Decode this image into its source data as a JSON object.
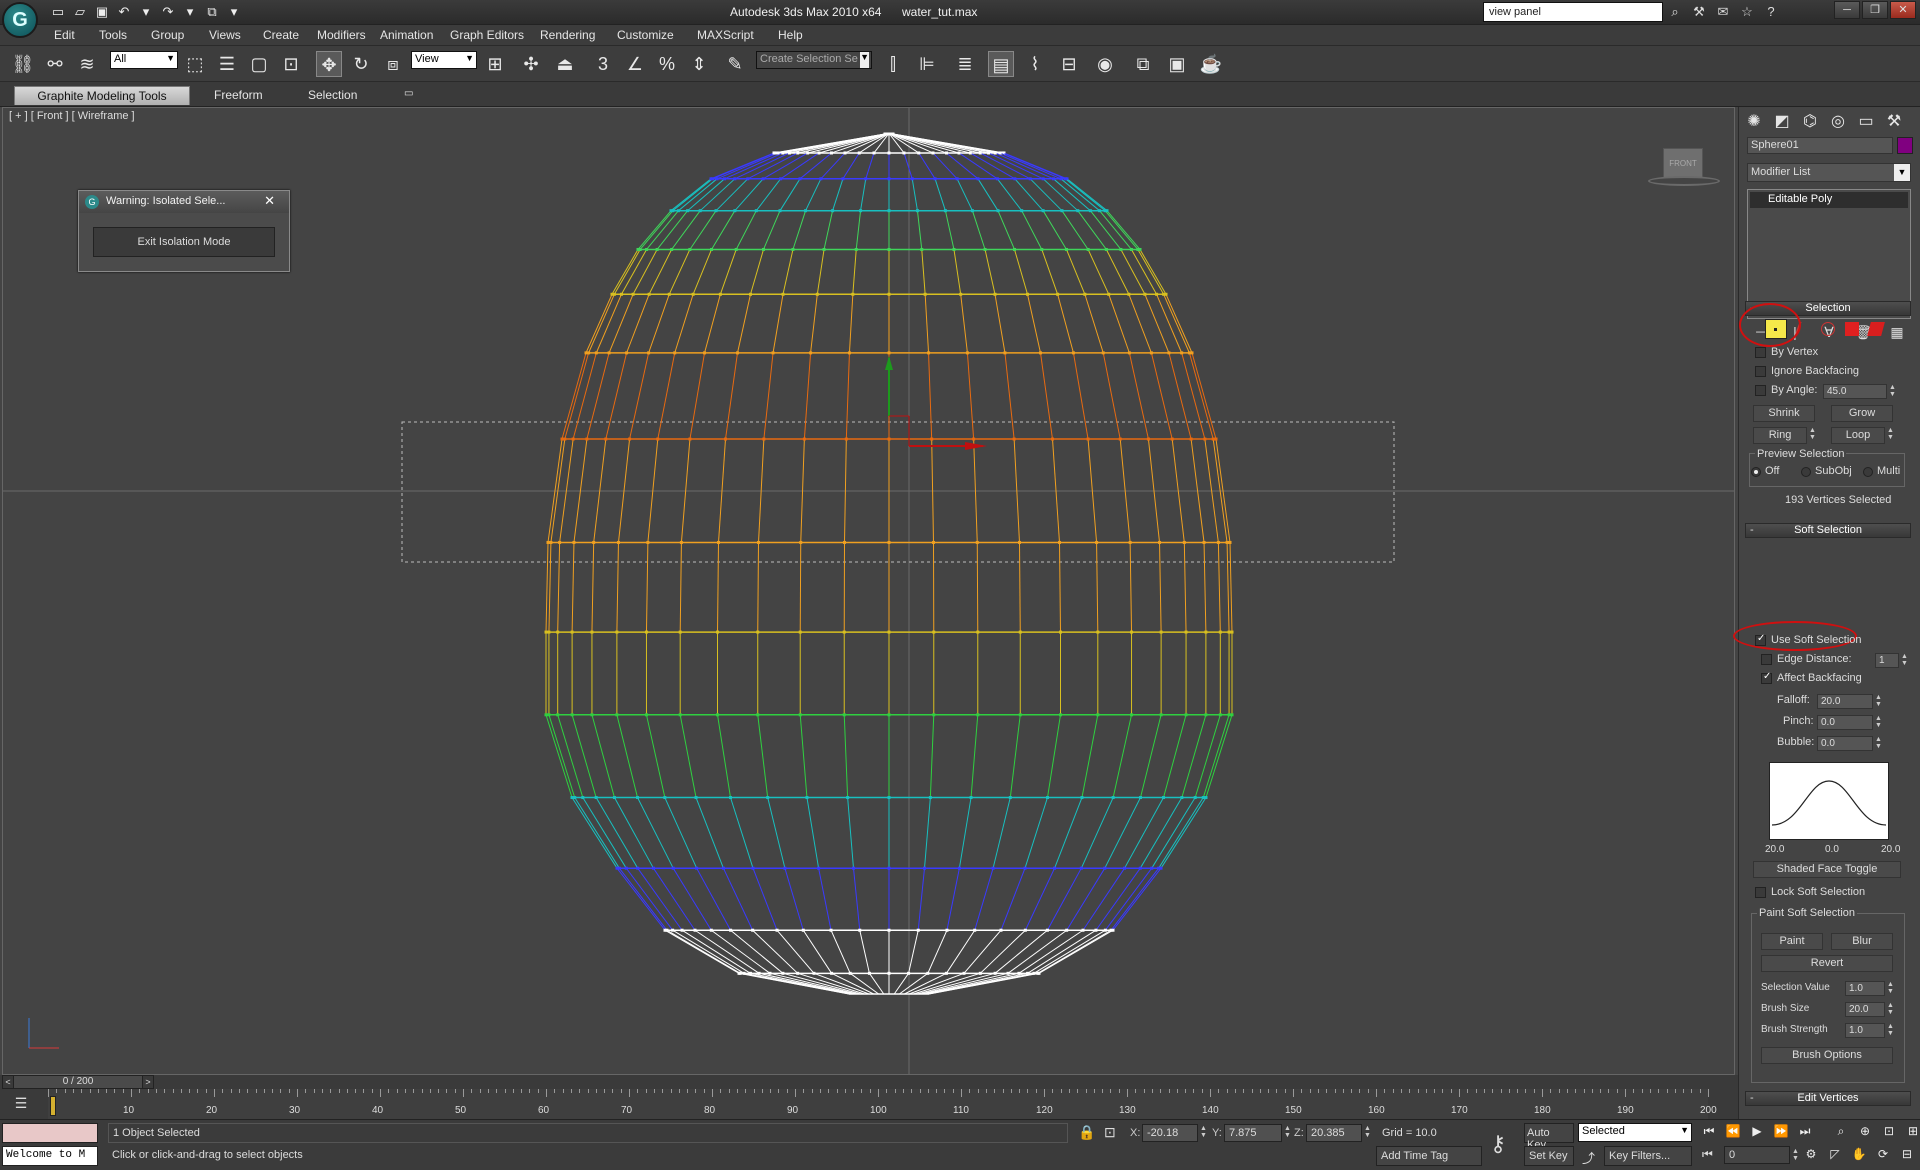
{
  "app": {
    "title": "Autodesk 3ds Max  2010 x64",
    "filename": "water_tut.max",
    "search_text": "view panel"
  },
  "menu": [
    "Edit",
    "Tools",
    "Group",
    "Views",
    "Create",
    "Modifiers",
    "Animation",
    "Graph Editors",
    "Rendering",
    "Customize",
    "MAXScript",
    "Help"
  ],
  "toolbar": {
    "filter_value": "All",
    "coord_system": "View",
    "selection_set_placeholder": "Create Selection Se"
  },
  "ribbon": {
    "tabs": [
      "Graphite Modeling Tools",
      "Freeform",
      "Selection"
    ]
  },
  "viewport": {
    "label": "[ + ] [ Front ] [ Wireframe ]",
    "viewcube_label": "FRONT"
  },
  "dialog": {
    "title": "Warning: Isolated Sele...",
    "button": "Exit Isolation Mode"
  },
  "command_panel": {
    "object_name": "Sphere01",
    "object_color": "#800080",
    "modifier_list": "Modifier List",
    "stack_item": "Editable Poly",
    "selection_rollout": {
      "title": "Selection",
      "by_vertex": "By Vertex",
      "ignore_backfacing": "Ignore Backfacing",
      "by_angle": "By Angle:",
      "by_angle_value": "45.0",
      "shrink": "Shrink",
      "grow": "Grow",
      "ring": "Ring",
      "loop": "Loop",
      "preview_selection": "Preview Selection",
      "preview_off": "Off",
      "preview_subobj": "SubObj",
      "preview_multi": "Multi",
      "status": "193 Vertices Selected"
    },
    "soft_selection": {
      "title": "Soft Selection",
      "use_soft_selection": "Use Soft Selection",
      "edge_distance": "Edge Distance:",
      "edge_distance_value": "1",
      "affect_backfacing": "Affect Backfacing",
      "falloff_label": "Falloff:",
      "falloff": "20.0",
      "pinch_label": "Pinch:",
      "pinch": "0.0",
      "bubble_label": "Bubble:",
      "bubble": "0.0",
      "curve_left": "20.0",
      "curve_mid": "0.0",
      "curve_right": "20.0",
      "shaded_face_toggle": "Shaded Face Toggle",
      "lock_soft_selection": "Lock Soft Selection",
      "paint_group": "Paint Soft Selection",
      "paint": "Paint",
      "blur": "Blur",
      "revert": "Revert",
      "selection_value_label": "Selection Value",
      "selection_value": "1.0",
      "brush_size_label": "Brush Size",
      "brush_size": "20.0",
      "brush_strength_label": "Brush Strength",
      "brush_strength": "1.0",
      "brush_options": "Brush Options"
    },
    "edit_vertices": "Edit Vertices"
  },
  "timeline": {
    "frame": "0 / 200",
    "ticks": [
      "10",
      "20",
      "30",
      "40",
      "50",
      "60",
      "70",
      "80",
      "90",
      "100",
      "110",
      "120",
      "130",
      "140",
      "150",
      "160",
      "170",
      "180",
      "190",
      "200"
    ]
  },
  "status": {
    "maxscript_text": "Welcome to M",
    "objects_selected": "1 Object Selected",
    "prompt": "Click or click-and-drag to select objects",
    "x_label": "X:",
    "x": "-20.18",
    "y_label": "Y:",
    "y": "7.875",
    "z_label": "Z:",
    "z": "20.385",
    "grid": "Grid = 10.0",
    "add_time_tag": "Add Time Tag",
    "auto_key": "Auto Key",
    "set_key": "Set Key",
    "key_mode": "Selected",
    "key_filters": "Key Filters...",
    "current_frame": "0"
  }
}
